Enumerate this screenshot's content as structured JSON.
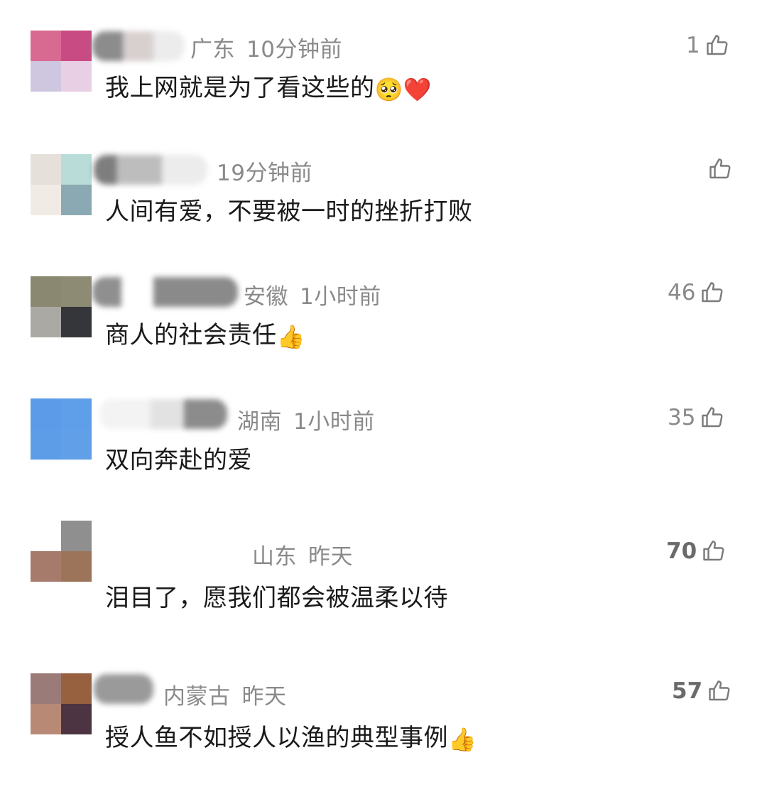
{
  "comments": [
    {
      "location": "广东",
      "time": "10分钟前",
      "text": "我上网就是为了看这些的",
      "emoji": [
        "pleading-face",
        "red-heart"
      ],
      "emoji_glyphs": "🥺❤️",
      "likes": "1",
      "avatar_colors": [
        "#d86a92",
        "#c94b83",
        "#cfc7e0",
        "#e9cfe3"
      ]
    },
    {
      "location": "",
      "time": "19分钟前",
      "text": "人间有爱，不要被一时的挫折打败",
      "emoji": [],
      "emoji_glyphs": "",
      "likes": "",
      "avatar_colors": [
        "#e6e0da",
        "#b9dcd8",
        "#f1ebe6",
        "#8ba9b2"
      ]
    },
    {
      "location": "安徽",
      "time": "1小时前",
      "text": "商人的社会责任",
      "emoji": [
        "thumbs-up"
      ],
      "emoji_glyphs": "👍",
      "likes": "46",
      "avatar_colors": [
        "#8a8870",
        "#8e8b75",
        "#aaa9a3",
        "#35363a"
      ]
    },
    {
      "location": "湖南",
      "time": "1小时前",
      "text": "双向奔赴的爱",
      "emoji": [],
      "emoji_glyphs": "",
      "likes": "35",
      "avatar_colors": [
        "#5b9be8",
        "#5f9ee9",
        "#5d9de8",
        "#619fe9"
      ]
    },
    {
      "location": "山东",
      "time": "昨天",
      "text": "泪目了，愿我们都会被温柔以待",
      "emoji": [],
      "emoji_glyphs": "",
      "likes": "70",
      "avatar_colors": [
        "#ffffff",
        "#8f8f8f",
        "#a67b6c",
        "#9c7459"
      ]
    },
    {
      "location": "内蒙古",
      "time": "昨天",
      "text": "授人鱼不如授人以渔的典型事例",
      "emoji": [
        "thumbs-up"
      ],
      "emoji_glyphs": "👍",
      "likes": "57",
      "avatar_colors": [
        "#9b7b78",
        "#97603e",
        "#b88a76",
        "#4c3442"
      ]
    }
  ],
  "colors": {
    "meta_text": "#8a8a8a",
    "comment_text": "#1a1a1a",
    "like_icon": "#7a7a7a"
  }
}
